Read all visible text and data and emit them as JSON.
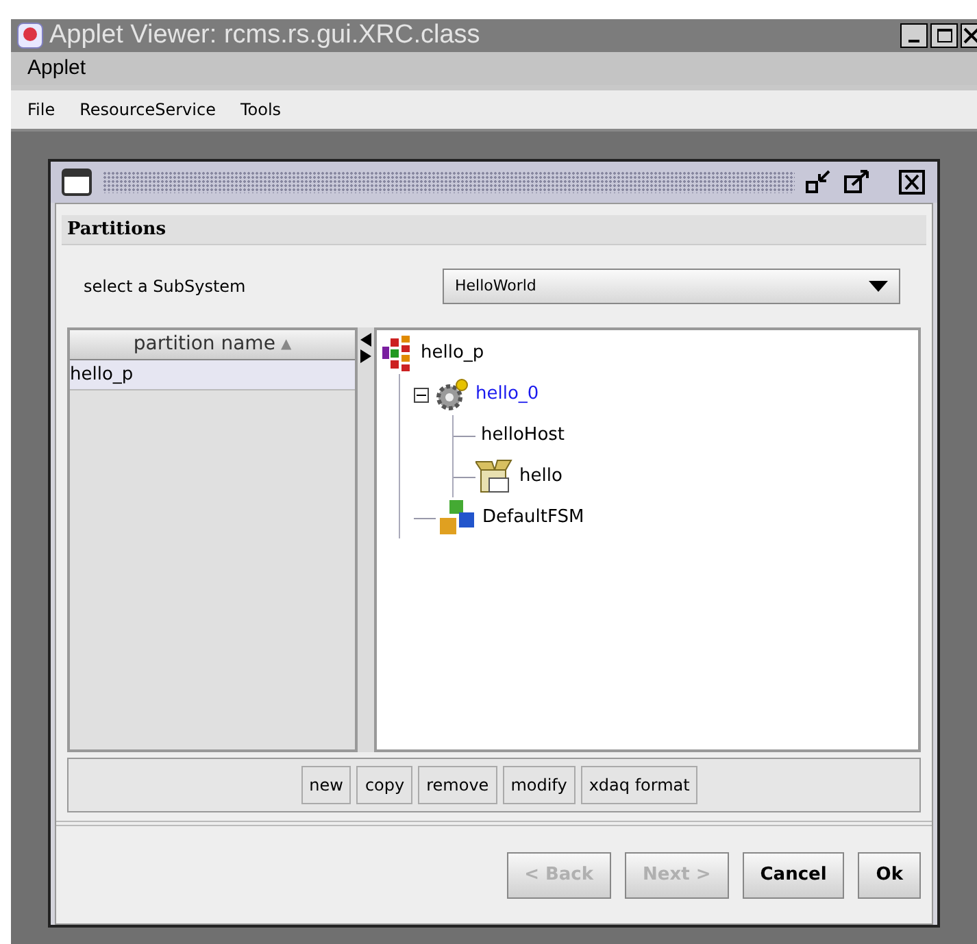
{
  "window": {
    "title": "Applet Viewer: rcms.rs.gui.XRC.class"
  },
  "applet_menu": {
    "label": "Applet"
  },
  "menu_bar": [
    {
      "label": "File"
    },
    {
      "label": "ResourceService"
    },
    {
      "label": "Tools"
    }
  ],
  "panel": {
    "title": "Partitions",
    "subsystem_label": "select a SubSystem",
    "subsystem_value": "HelloWorld"
  },
  "table": {
    "columns": [
      "partition name"
    ],
    "sort_mark": "▲",
    "rows": [
      {
        "cells": [
          "hello_p"
        ],
        "selected": true
      }
    ]
  },
  "tree": [
    {
      "label": "hello_p",
      "kind": "partition",
      "selected": false,
      "children": [
        {
          "label": "hello_0",
          "kind": "gear",
          "selected": true,
          "expanded": true,
          "children": [
            {
              "label": "helloHost",
              "kind": "leaf",
              "selected": false
            },
            {
              "label": "hello",
              "kind": "package",
              "selected": false
            }
          ]
        },
        {
          "label": "DefaultFSM",
          "kind": "blocks",
          "selected": false
        }
      ]
    }
  ],
  "action_buttons": [
    "new",
    "copy",
    "remove",
    "modify",
    "xdaq format"
  ],
  "wizard_buttons": [
    {
      "label": "< Back",
      "disabled": true
    },
    {
      "label": "Next >",
      "disabled": true
    },
    {
      "label": "Cancel",
      "disabled": false
    },
    {
      "label": "Ok",
      "disabled": false
    }
  ]
}
